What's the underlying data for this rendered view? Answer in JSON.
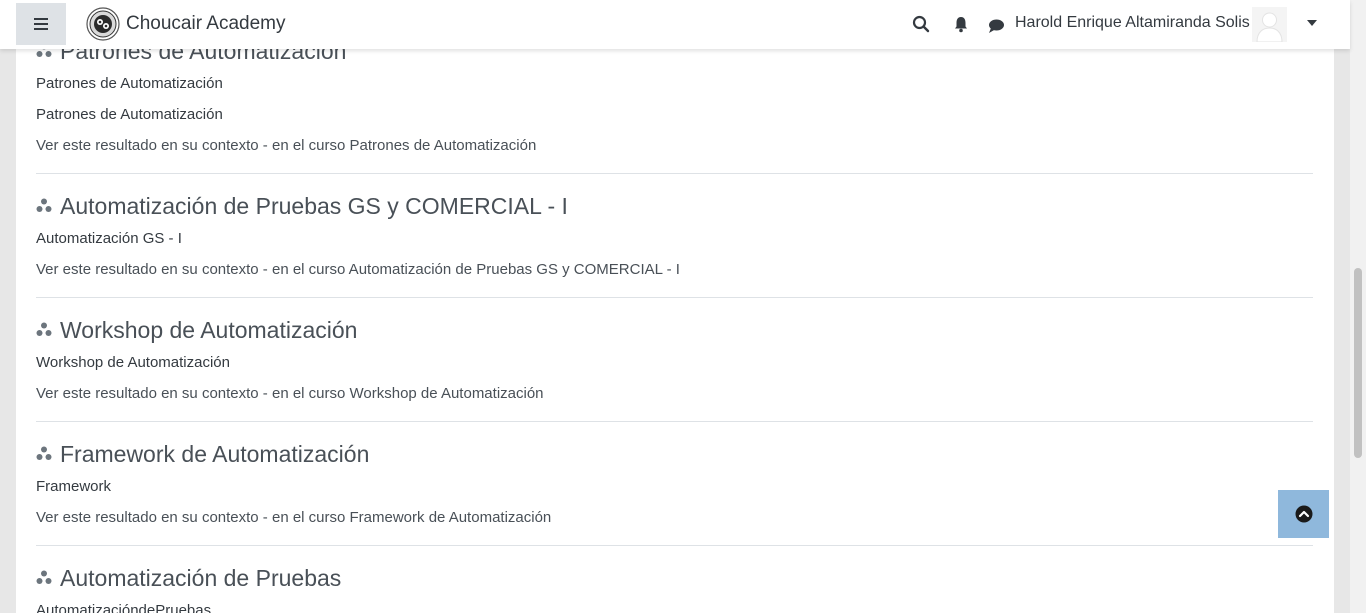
{
  "navbar": {
    "brand": "Choucair Academy",
    "user_name": "Harold Enrique Altamiranda Solis"
  },
  "results": [
    {
      "title": "Patrones de Automatización",
      "lines": [
        "Patrones de Automatización",
        "Patrones de Automatización"
      ],
      "context": "Ver este resultado en su contexto - en el curso Patrones de Automatización"
    },
    {
      "title": "Automatización de Pruebas GS y COMERCIAL - I",
      "lines": [
        "Automatización GS - I"
      ],
      "context": "Ver este resultado en su contexto - en el curso Automatización de Pruebas GS y COMERCIAL - I"
    },
    {
      "title": "Workshop de Automatización",
      "lines": [
        "Workshop de Automatización"
      ],
      "context": "Ver este resultado en su contexto - en el curso Workshop de Automatización"
    },
    {
      "title": "Framework de Automatización",
      "lines": [
        "Framework"
      ],
      "context": "Ver este resultado en su contexto - en el curso Framework de Automatización"
    },
    {
      "title": "Automatización de Pruebas",
      "lines": [
        "AutomatizacióndePruebas"
      ],
      "context": ""
    }
  ],
  "icons": {
    "drawer": "hamburger-icon",
    "search": "search-icon",
    "notifications": "bell-icon",
    "messages": "chat-bubble-icon",
    "user_menu": "caret-down-icon",
    "course": "course-icon",
    "back_to_top": "chevron-up-circle-icon"
  },
  "colors": {
    "page_bg": "#e7e7e7",
    "card_bg": "#ffffff",
    "back_to_top": "#8fb8dc"
  }
}
